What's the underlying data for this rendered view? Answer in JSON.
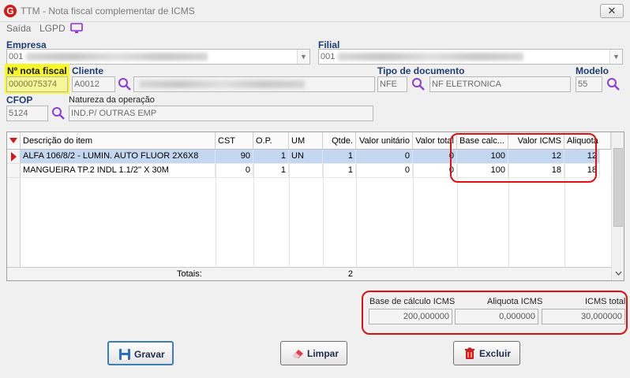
{
  "window": {
    "title": "TTM - Nota fiscal complementar de ICMS",
    "close_label": "✕"
  },
  "menu": {
    "items": [
      "Saída",
      "LGPD"
    ]
  },
  "form": {
    "empresa_label": "Empresa",
    "empresa_value": "001",
    "filial_label": "Filial",
    "filial_value": "001",
    "nota_label": "Nº nota fiscal",
    "nota_value": "0000075374",
    "cliente_label": "Cliente",
    "cliente_code": "A0012",
    "tipo_doc_label": "Tipo de documento",
    "tipo_doc_code": "NFE",
    "tipo_doc_desc": "NF ELETRONICA",
    "modelo_label": "Modelo",
    "modelo_value": "55",
    "cfop_label": "CFOP",
    "cfop_value": "5124",
    "natureza_label": "Natureza da operação",
    "natureza_value": "IND.P/ OUTRAS EMP"
  },
  "grid": {
    "columns": [
      "Descrição do item",
      "CST",
      "O.P.",
      "UM",
      "Qtde.",
      "Valor unitário",
      "Valor total",
      "Base calc...",
      "Valor ICMS",
      "Aliquota"
    ],
    "rows": [
      {
        "desc": "ALFA 106/8/2 - LUMIN. AUTO FLUOR 2X6X8",
        "cst": "90",
        "op": "1",
        "um": "UN",
        "qtde": "1",
        "vunit": "0",
        "vtotal": "0",
        "base": "100",
        "icms": "12",
        "aliq": "12"
      },
      {
        "desc": "MANGUEIRA TP.2 INDL 1.1/2'' X 30M",
        "cst": "0",
        "op": "1",
        "um": "",
        "qtde": "1",
        "vunit": "0",
        "vtotal": "0",
        "base": "100",
        "icms": "18",
        "aliq": "18"
      }
    ],
    "totals_label": "Totais:",
    "totals_qtde": "2"
  },
  "totals": {
    "base_label": "Base de cálculo ICMS",
    "base_value": "200,000000",
    "aliq_label": "Aliquota ICMS",
    "aliq_value": "0,000000",
    "icms_label": "ICMS total",
    "icms_value": "30,000000"
  },
  "buttons": {
    "gravar": "Gravar",
    "limpar": "Limpar",
    "excluir": "Excluir"
  },
  "colors": {
    "accent": "#1f3b73",
    "highlight": "#f7f72a",
    "annotation": "#e01010",
    "selection": "#c3d7f0"
  }
}
